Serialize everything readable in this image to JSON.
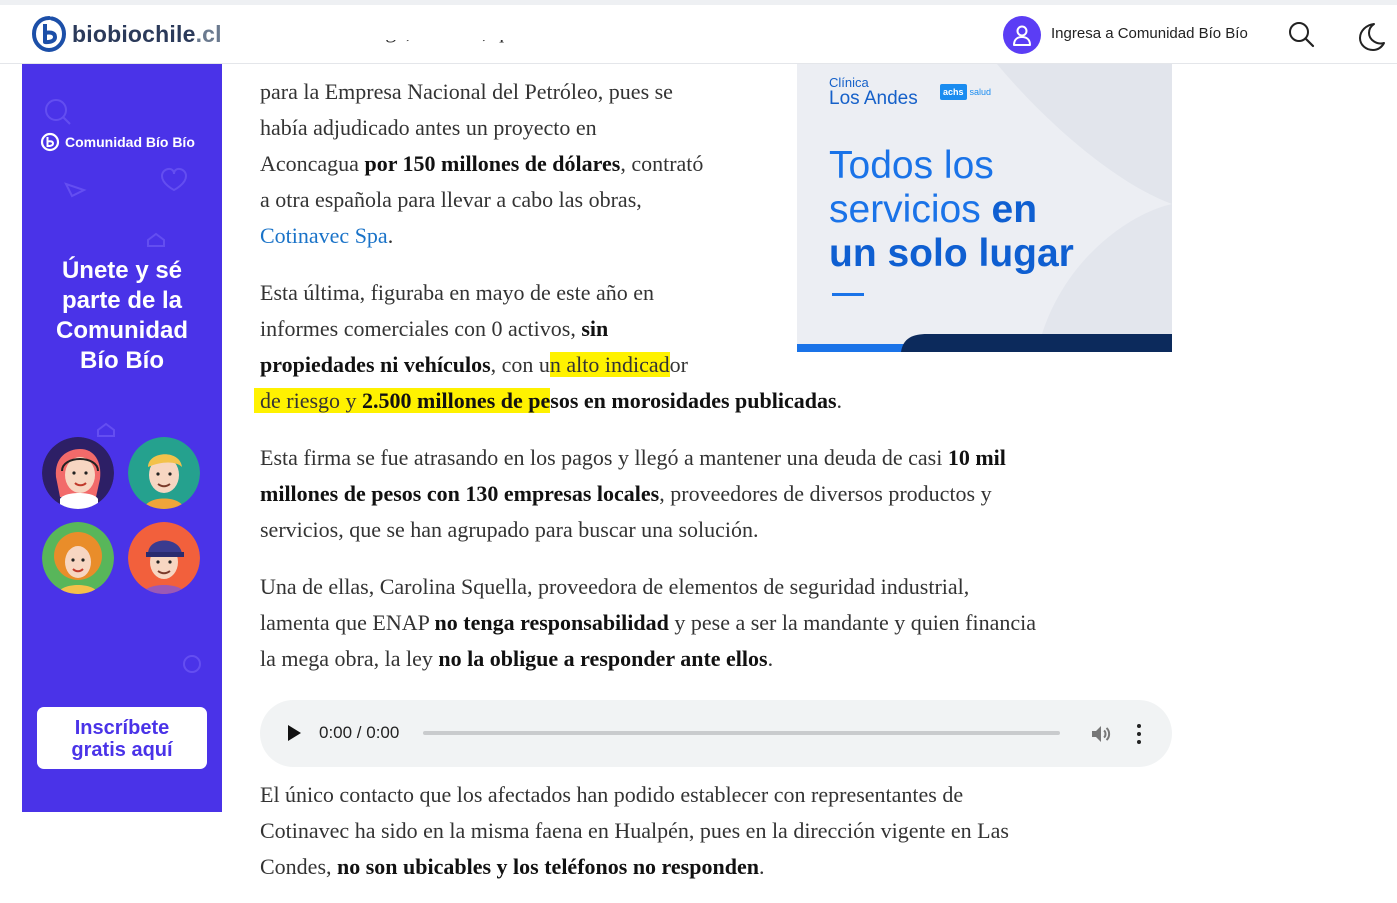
{
  "header": {
    "logo_main": "biobiochile",
    "logo_tld": ".cl",
    "login_label": "Ingresa a Comunidad Bío Bío",
    "icons": {
      "user": "user-icon",
      "search": "search-icon",
      "theme": "moon-icon"
    },
    "accent": "#5b3df5"
  },
  "left_banner": {
    "brand": "Comunidad Bío Bío",
    "headline_lines": [
      "Únete y sé",
      "parte de la",
      "Comunidad",
      "Bío Bío"
    ],
    "cta_line1": "Inscríbete",
    "cta_line2": "gratis aquí",
    "background": "#4a33e8"
  },
  "right_ad": {
    "clinic_small": "Clínica",
    "clinic_big": "Los Andes",
    "achs_box": "achs",
    "achs_salud": "salud",
    "headline_line1": "Todos los",
    "headline_line2_regular": "servicios ",
    "headline_line2_bold": "en",
    "headline_line3": "un solo lugar"
  },
  "article": {
    "p1": {
      "l1": "para la Empresa Nacional del Petróleo, pues se",
      "l2": "había adjudicado antes un proyecto en",
      "l3a": "Aconcagua ",
      "l3b": "por 150 millones de dólares",
      "l3c": ", contrató",
      "l4": "a otra española para llevar a cabo las obras,",
      "l5_link": "Cotinavec Spa",
      "l5_end": "."
    },
    "p2": {
      "l1": "Esta última, figuraba en mayo de este año en",
      "l2a": "informes comerciales con 0 activos, ",
      "l2b": "sin",
      "l3a": "propiedades ni vehículos",
      "l3b": ", con u",
      "l3c": "n alto indicad",
      "l3d": "or",
      "l4a": "de riesgo y ",
      "l4b": "2.500 millones de pe",
      "l4c": "sos en morosidades publicadas",
      "l4d": "."
    },
    "p3": {
      "l1a": "Esta firma se fue atrasando en los pagos y llegó a mantener una deuda de casi ",
      "l1b": "10 mil",
      "l2a": "millones de pesos con 130 empresas locales",
      "l2b": ", proveedores de diversos productos y",
      "l3": "servicios, que se han agrupado para buscar una solución."
    },
    "p4": {
      "l1": "Una de ellas, Carolina Squella, proveedora de elementos de seguridad industrial,",
      "l2a": "lamenta que ENAP ",
      "l2b": "no tenga responsabilidad",
      "l2c": " y pese a ser la mandante y quien financia",
      "l3a": "la mega obra, la ley ",
      "l3b": "no la obligue a responder ante ellos",
      "l3c": "."
    },
    "p5": {
      "l1": "El único contacto que los afectados han podido establecer con representantes de",
      "l2": "Cotinavec ha sido en la misma faena en Hualpén, pues en la dirección vigente en Las",
      "l3a": "Condes, ",
      "l3b": "no son ubicables y los teléfonos no responden",
      "l3c": "."
    },
    "highlight_color": "#fff200",
    "link_color": "#1a73c8"
  },
  "audio_player": {
    "time": "0:00 / 0:00",
    "progress": 0,
    "icons": {
      "play": "play-icon",
      "volume": "volume-icon",
      "more": "more-vert-icon"
    }
  }
}
